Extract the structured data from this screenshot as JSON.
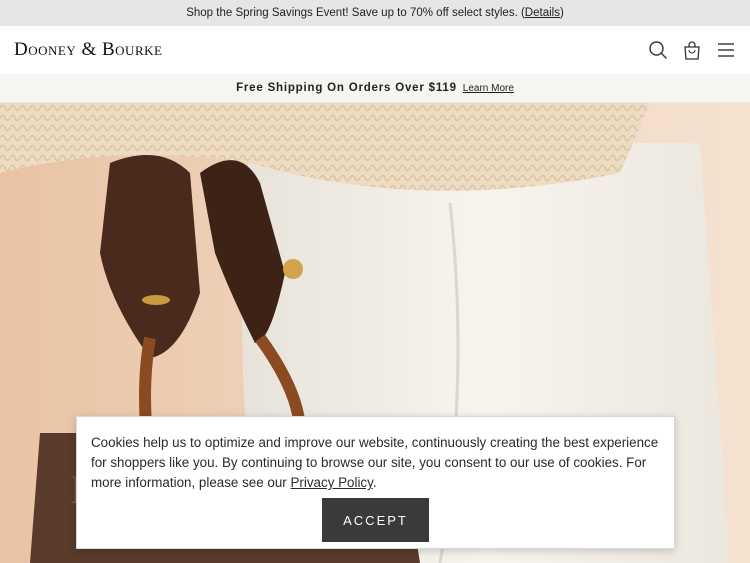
{
  "promo": {
    "text": "Shop the Spring Savings Event! Save up to 70% off select styles. (",
    "details_label": "Details",
    "close_paren": ")"
  },
  "header": {
    "logo": "Dooney & Bourke",
    "icons": [
      "search-icon",
      "shopping-bag-icon",
      "menu-icon"
    ]
  },
  "shipping": {
    "text": "Free Shipping On Orders Over $119",
    "learn_more": "Learn More"
  },
  "cookie": {
    "text": "Cookies help us to optimize and improve our website, continuously creating the best experience for shoppers like you. By continuing to browse our site, you consent to our use of cookies. For more information, please see our ",
    "privacy_label": "Privacy Policy",
    "period": ".",
    "accept_label": "ACCEPT"
  },
  "colors": {
    "promo_bg": "#e6e6e4",
    "accept_bg": "#3a3a3a",
    "hero_skin": "#e9c3a4"
  }
}
